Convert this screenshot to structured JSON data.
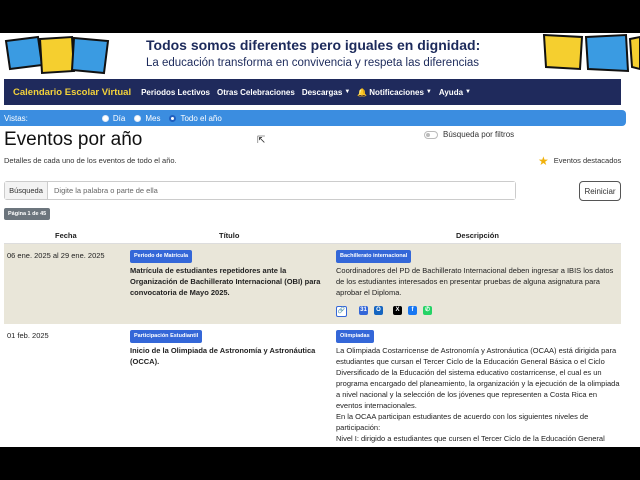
{
  "banner": {
    "title": "Todos somos diferentes pero iguales en dignidad:",
    "subtitle": "La educación transforma en convivencia y respeta las diferencias"
  },
  "navbar": {
    "brand": "Calendario Escolar Virtual",
    "items": [
      "Periodos Lectivos",
      "Otras Celebraciones",
      "Descargas",
      "Notificaciones",
      "Ayuda"
    ]
  },
  "views": {
    "label": "Vistas:",
    "options": [
      "Día",
      "Mes",
      "Todo el año"
    ],
    "selected": "Todo el año"
  },
  "page": {
    "title": "Eventos por año",
    "description": "Detalles de cada uno de los eventos de todo el año.",
    "filter_label": "Búsqueda por filtros",
    "featured_label": "Eventos destacados"
  },
  "search": {
    "label": "Búsqueda",
    "placeholder": "Digite la palabra o parte de ella",
    "reset_label": "Reiniciar"
  },
  "pagination": {
    "label": "Página 1 de 45"
  },
  "table": {
    "headers": [
      "Fecha",
      "Título",
      "Descripción"
    ],
    "rows": [
      {
        "date": "06 ene. 2025 al 29 ene. 2025",
        "title_badge": "Periodo de Matrícula",
        "title": "Matrícula de estudiantes repetidores ante la Organización de Bachillerato Internacional (OBI) para convocatoria de Mayo 2025.",
        "desc_badge": "Bachillerato internacional",
        "description": "Coordinadores del PD de Bachillerato Internacional deben ingresar a IBIS los datos de los estudiantes interesados en presentar pruebas de alguna asignatura para aprobar el Diploma."
      },
      {
        "date": "01 feb. 2025",
        "title_badge": "Participación Estudiantil",
        "title": "Inicio de la Olimpiada de Astronomía y Astronáutica (OCCA).",
        "desc_badge": "Olimpiadas",
        "description": "La Olimpiada Costarricense de Astronomía y Astronáutica (OCAA) está dirigida para estudiantes que cursan el Tercer Ciclo de la Educación General Básica o el Ciclo Diversificado de la Educación del sistema educativo costarricense, el cual es un programa encargado del planeamiento, la organización y la ejecución de la olimpiada a nivel nacional y la selección de los jóvenes que representen a Costa Rica en eventos internacionales.",
        "description_2": "En la OCAA participan estudiantes de acuerdo con los siguientes niveles de participación:",
        "description_3": "Nivel I: dirigido a estudiantes que cursen el Tercer Ciclo de la Educación General"
      }
    ]
  },
  "colors": {
    "navbar": "#1f2a5c",
    "brand": "#f3d23b",
    "viewbar": "#3b8de0",
    "badge": "#3467d8",
    "row_highlight": "#e9e6d9"
  }
}
